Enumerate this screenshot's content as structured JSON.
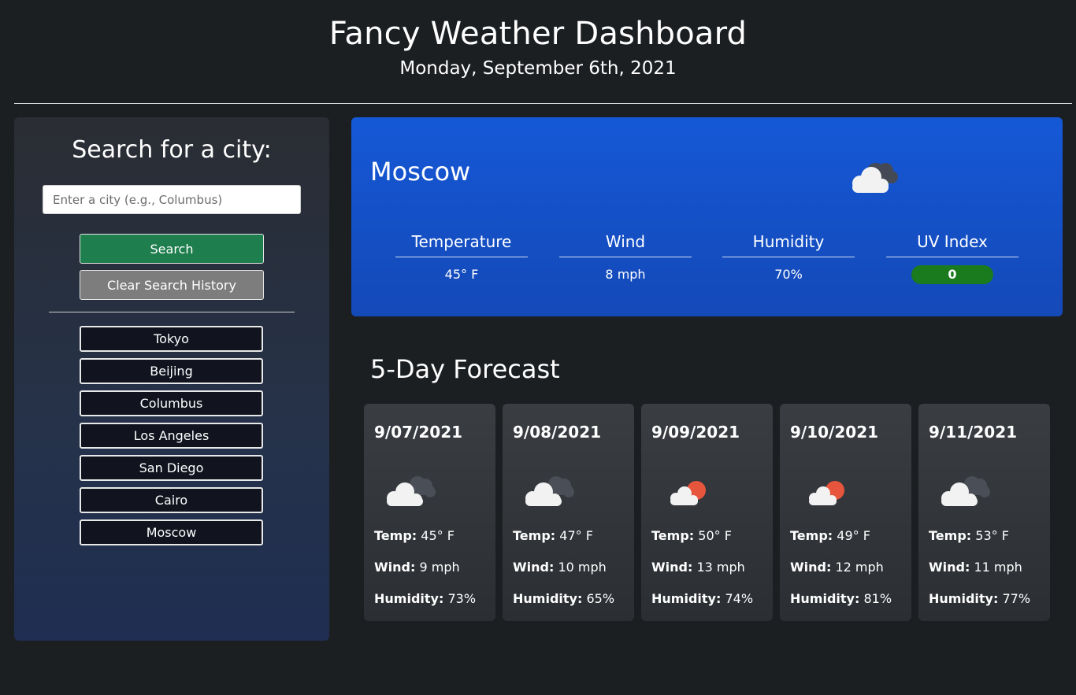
{
  "header": {
    "title": "Fancy Weather Dashboard",
    "date": "Monday, September 6th, 2021"
  },
  "sidebar": {
    "title": "Search for a city:",
    "input_placeholder": "Enter a city (e.g., Columbus)",
    "input_value": "",
    "search_label": "Search",
    "clear_label": "Clear Search History",
    "history": [
      "Tokyo",
      "Beijing",
      "Columbus",
      "Los Angeles",
      "San Diego",
      "Cairo",
      "Moscow"
    ]
  },
  "current": {
    "city": "Moscow",
    "icon": "cloudy-icon",
    "stats": [
      {
        "label": "Temperature",
        "value": "45° F"
      },
      {
        "label": "Wind",
        "value": "8 mph"
      },
      {
        "label": "Humidity",
        "value": "70%"
      },
      {
        "label": "UV Index",
        "value": "0"
      }
    ],
    "uv_color": "#1a7a1e"
  },
  "forecast": {
    "title": "5-Day Forecast",
    "temp_label": "Temp:",
    "wind_label": "Wind:",
    "humidity_label": "Humidity:",
    "days": [
      {
        "date": "9/07/2021",
        "icon": "cloudy-icon",
        "temp": "45° F",
        "wind": "9 mph",
        "humidity": "73%"
      },
      {
        "date": "9/08/2021",
        "icon": "cloudy-icon",
        "temp": "47° F",
        "wind": "10 mph",
        "humidity": "65%"
      },
      {
        "date": "9/09/2021",
        "icon": "sun-cloud-icon",
        "temp": "50° F",
        "wind": "13 mph",
        "humidity": "74%"
      },
      {
        "date": "9/10/2021",
        "icon": "sun-cloud-icon",
        "temp": "49° F",
        "wind": "12 mph",
        "humidity": "81%"
      },
      {
        "date": "9/11/2021",
        "icon": "cloudy-icon",
        "temp": "53° F",
        "wind": "11 mph",
        "humidity": "77%"
      }
    ]
  }
}
